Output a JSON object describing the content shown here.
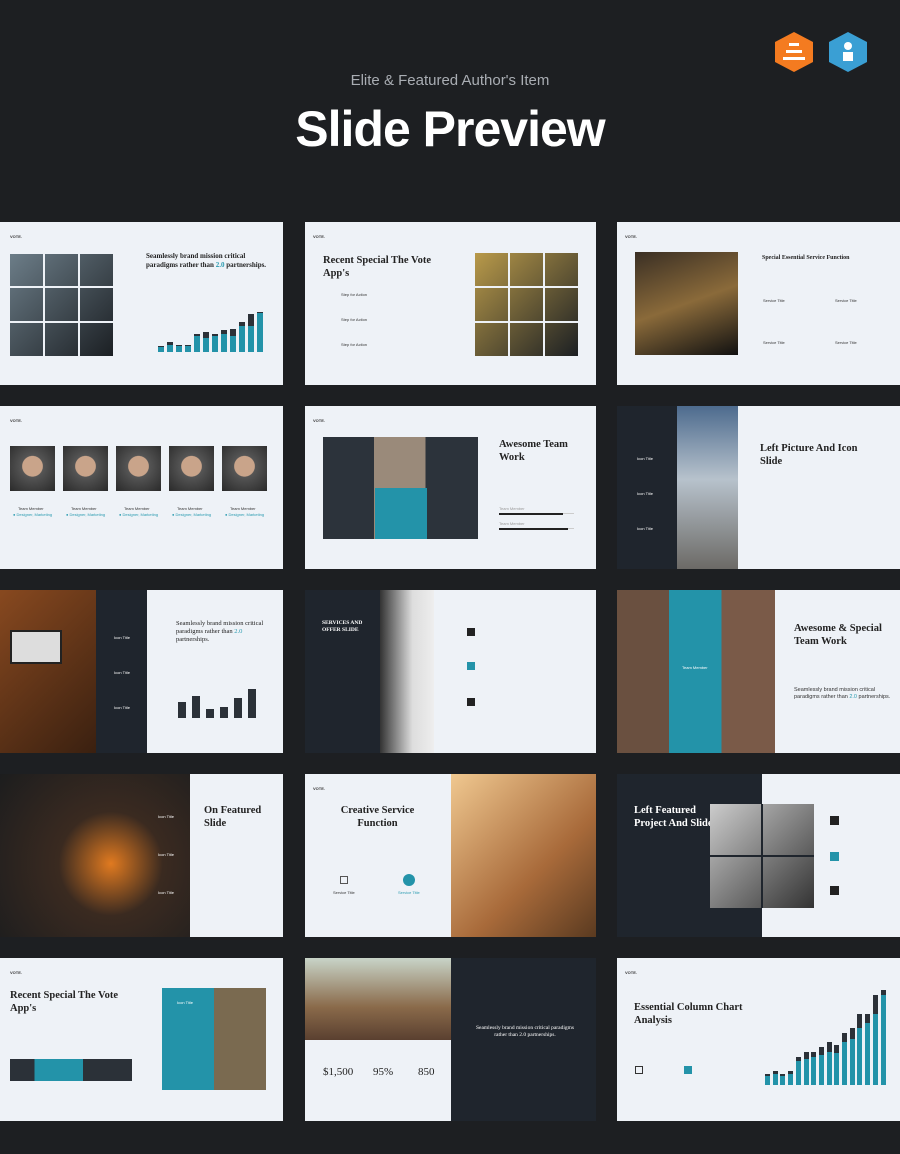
{
  "header": {
    "subtitle": "Elite & Featured Author's Item",
    "title": "Slide Preview",
    "badges": [
      {
        "icon": "elite-author-icon",
        "color": "#f47b20"
      },
      {
        "icon": "featured-author-icon",
        "color": "#3a9fd4"
      }
    ]
  },
  "accent": "#2393a9",
  "logo": "VOTE.",
  "slides": {
    "s1": {
      "title_a": "Seamlessly brand mission critical paradigms rather than ",
      "title_b": "2.0",
      "title_c": " partnerships.",
      "chart": [
        {
          "total": 15,
          "dark": 3
        },
        {
          "total": 25,
          "dark": 8
        },
        {
          "total": 18,
          "dark": 3
        },
        {
          "total": 18,
          "dark": 3
        },
        {
          "total": 45,
          "dark": 5
        },
        {
          "total": 50,
          "dark": 15
        },
        {
          "total": 45,
          "dark": 5
        },
        {
          "total": 55,
          "dark": 10
        },
        {
          "total": 58,
          "dark": 18
        },
        {
          "total": 75,
          "dark": 10
        },
        {
          "total": 95,
          "dark": 30
        },
        {
          "total": 100,
          "dark": 3
        }
      ]
    },
    "s2": {
      "title": "Recent Special The Vote App's",
      "items": [
        "Step for Action",
        "Step for Action",
        "Step for Action"
      ]
    },
    "s3": {
      "title": "Special Essential Service Function",
      "items": [
        "Service Title",
        "Service Title",
        "Service Title",
        "Service Title"
      ]
    },
    "s4": {
      "members": [
        {
          "name": "Team Member",
          "role": "● Designer, Marketing"
        },
        {
          "name": "Team Member",
          "role": "● Designer, Marketing"
        },
        {
          "name": "Team Member",
          "role": "● Designer, Marketing"
        },
        {
          "name": "Team Member",
          "role": "● Designer, Marketing"
        },
        {
          "name": "Team Member",
          "role": "● Designer, Marketing"
        }
      ]
    },
    "s5": {
      "title": "Awesome Team Work",
      "label_a": "Team Member",
      "label_b": "Team Member",
      "progress": [
        0.85,
        0.92
      ]
    },
    "s6": {
      "title": "Left Picture And Icon Slide",
      "items": [
        "Icon Title",
        "Icon Title",
        "Icon Title"
      ]
    },
    "s7": {
      "title_a": "Seamlessly brand mission critical paradigms rather than ",
      "title_b": "2.0",
      "title_c": " partnerships.",
      "items": [
        "Icon Title",
        "Icon Title",
        "Icon Title"
      ],
      "chart": [
        45,
        60,
        25,
        30,
        55,
        80
      ]
    },
    "s8": {
      "title": "SERVICES AND OFFER SLIDE"
    },
    "s9": {
      "title": "Awesome & Special Team Work",
      "text_a": "Seamlessly brand mission critical paradigms rather than ",
      "text_b": "2.0",
      "text_c": " partnerships.",
      "member": "Team Member"
    },
    "s10": {
      "title": "On Featured Slide",
      "items": [
        "Icon Title",
        "Icon Title",
        "Icon Title"
      ]
    },
    "s11": {
      "title": "Creative Service Function",
      "items": [
        "Service Title",
        "Service Title"
      ]
    },
    "s12": {
      "title": "Left Featured Project And Slide"
    },
    "s13": {
      "title": "Recent Special The Vote App's",
      "label": "Icon Title"
    },
    "s14": {
      "stats": [
        {
          "value": "$1,500"
        },
        {
          "value": "95%"
        },
        {
          "value": "850"
        }
      ],
      "text": "Seamlessly brand mission critical paradigms rather than 2.0 partnerships."
    },
    "s15": {
      "title": "Essential Column Chart Analysis",
      "chart": [
        {
          "total": 12,
          "dark": 2
        },
        {
          "total": 15,
          "dark": 3
        },
        {
          "total": 12,
          "dark": 2
        },
        {
          "total": 15,
          "dark": 3
        },
        {
          "total": 30,
          "dark": 5
        },
        {
          "total": 35,
          "dark": 8
        },
        {
          "total": 35,
          "dark": 5
        },
        {
          "total": 40,
          "dark": 8
        },
        {
          "total": 45,
          "dark": 10
        },
        {
          "total": 42,
          "dark": 8
        },
        {
          "total": 55,
          "dark": 10
        },
        {
          "total": 60,
          "dark": 12
        },
        {
          "total": 75,
          "dark": 15
        },
        {
          "total": 75,
          "dark": 10
        },
        {
          "total": 95,
          "dark": 20
        },
        {
          "total": 100,
          "dark": 5
        }
      ]
    }
  }
}
